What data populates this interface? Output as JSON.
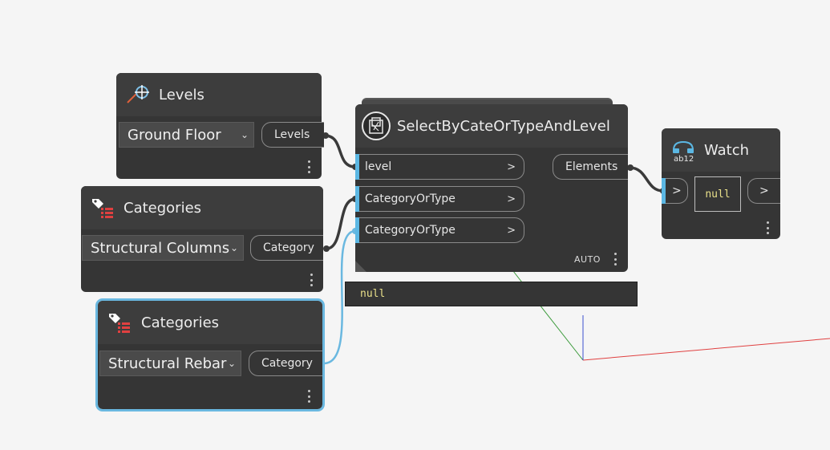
{
  "nodes": {
    "levels": {
      "title": "Levels",
      "icon": "level-crosshair-icon",
      "dropdown_value": "Ground Floor",
      "output_label": "Levels"
    },
    "categories_1": {
      "title": "Categories",
      "icon": "category-tag-list-icon",
      "dropdown_value": "Structural Columns",
      "output_label": "Category"
    },
    "categories_2": {
      "title": "Categories",
      "icon": "category-tag-list-icon",
      "dropdown_value": "Structural Rebar",
      "output_label": "Category",
      "selected": true
    },
    "select": {
      "title": "SelectByCateOrTypeAndLevel",
      "icon": "custom-node-icon",
      "inputs": [
        {
          "label": "level",
          "arrow": ">"
        },
        {
          "label": "CategoryOrType",
          "arrow": ">"
        },
        {
          "label": "CategoryOrType",
          "arrow": ">"
        }
      ],
      "output_label": "Elements",
      "lacing": "AUTO",
      "preview_value": "null"
    },
    "watch": {
      "title": "Watch",
      "icon": "watch-ab12-icon",
      "input_arrow": ">",
      "value": "null",
      "output_arrow": ">"
    }
  },
  "colors": {
    "background": "#f5f5f5",
    "node_body": "#353535",
    "node_header": "#3d3d3d",
    "port_accent": "#5bb7e3",
    "selection": "#6ab8e0",
    "wire": "#3a3a3a",
    "selected_wire": "#6ab8e0",
    "preview_text": "#e9e08a",
    "axis_x": "#e04040",
    "axis_y": "#3a9a3a",
    "axis_z": "#3a50d0"
  }
}
